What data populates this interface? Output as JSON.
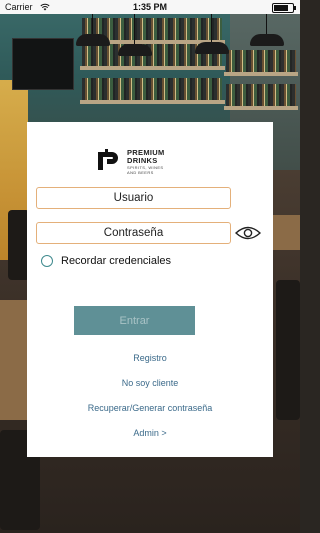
{
  "status_bar": {
    "carrier": "Carrier",
    "time": "1:35 PM",
    "battery_level": 0.9,
    "icons": [
      "wifi-icon",
      "battery-icon"
    ]
  },
  "background": {
    "description_icon": "bar-interior-photo"
  },
  "logo": {
    "title_line1": "PREMIUM",
    "title_line2": "DRINKS",
    "subtitle_line1": "SPIRITS, WINES",
    "subtitle_line2": "AND BEERS"
  },
  "form": {
    "username_placeholder": "Usuario",
    "password_placeholder": "Contraseña",
    "remember_label": "Recordar credenciales",
    "submit_label": "Entrar",
    "show_password_icon": "eye-icon"
  },
  "links": {
    "register": "Registro",
    "not_client": "No soy cliente",
    "recover_password": "Recuperar/Generar contraseña",
    "admin": "Admin >"
  },
  "colors": {
    "input_border": "#e4b07a",
    "accent_teal": "#5f9096",
    "radio_border": "#3f8a8e",
    "link_text": "#3b6a8a"
  }
}
